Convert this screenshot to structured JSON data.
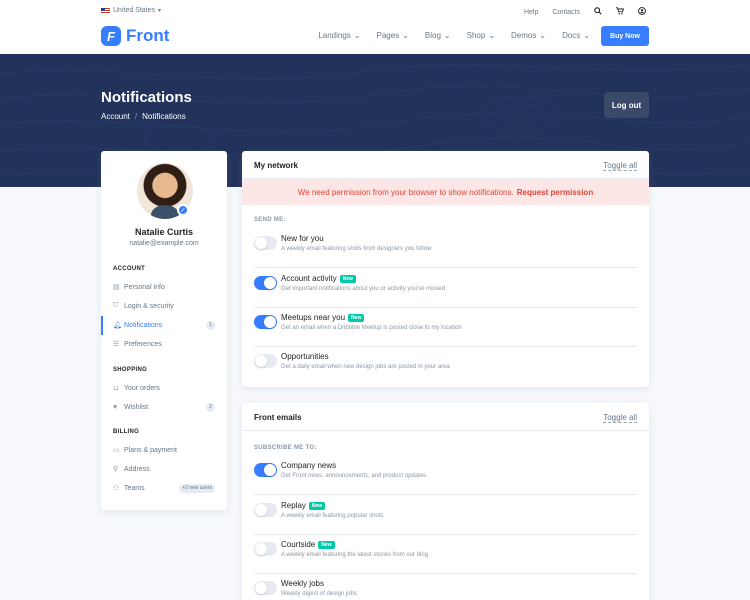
{
  "topbar": {
    "country": "United States",
    "links": [
      "Help",
      "Contacts"
    ],
    "brand": "Front",
    "brand_mark": "F",
    "nav": [
      "Landings",
      "Pages",
      "Blog",
      "Shop",
      "Demos",
      "Docs"
    ],
    "buy_label": "Buy Now"
  },
  "hero": {
    "title": "Notifications",
    "breadcrumb": [
      "Account",
      "Notifications"
    ],
    "logout_label": "Log out"
  },
  "profile": {
    "name": "Natalie Curtis",
    "email": "natalie@example.com"
  },
  "sidebar": {
    "account_heading": "ACCOUNT",
    "account_items": [
      {
        "label": "Personal info",
        "icon": "id-card-icon"
      },
      {
        "label": "Login & security",
        "icon": "shield-icon"
      },
      {
        "label": "Notifications",
        "icon": "bell-icon",
        "badge": "1",
        "active": true
      },
      {
        "label": "Preferences",
        "icon": "sliders-icon"
      }
    ],
    "shopping_heading": "SHOPPING",
    "shopping_items": [
      {
        "label": "Your orders",
        "icon": "basket-icon"
      },
      {
        "label": "Wishlist",
        "icon": "heart-icon",
        "badge": "2"
      }
    ],
    "billing_heading": "BILLING",
    "billing_items": [
      {
        "label": "Plans & payment",
        "icon": "credit-card-icon"
      },
      {
        "label": "Address",
        "icon": "map-pin-icon"
      },
      {
        "label": "Teams",
        "icon": "people-icon",
        "badge": "+2 new users"
      }
    ]
  },
  "network": {
    "title": "My network",
    "toggle_all": "Toggle all",
    "alert_text": "We need permission from your browser to show notifications.",
    "alert_link": "Request permission",
    "section_label": "SEND ME:",
    "items": [
      {
        "title": "New for you",
        "desc": "A weekly email featuring shots from designers you follow",
        "on": false,
        "new": ""
      },
      {
        "title": "Account activity",
        "desc": "Get important notifications about you or activity you've missed",
        "on": true,
        "new": "New"
      },
      {
        "title": "Meetups near you",
        "desc": "Get an email when a Dribbble Meetup is posted close to my location",
        "on": true,
        "new": "New"
      },
      {
        "title": "Opportunities",
        "desc": "Get a daily email when new design jobs are posted in your area",
        "on": false,
        "new": ""
      }
    ]
  },
  "emails": {
    "title": "Front emails",
    "toggle_all": "Toggle all",
    "section_label": "SUBSCRIBE ME TO:",
    "items": [
      {
        "title": "Company news",
        "desc": "Get Front news, announcements, and product updates",
        "on": true,
        "new": ""
      },
      {
        "title": "Replay",
        "desc": "A weekly email featuring popular shots",
        "on": false,
        "new": "New"
      },
      {
        "title": "Courtside",
        "desc": "A weekly email featuring the latest stories from our blog",
        "on": false,
        "new": "New"
      },
      {
        "title": "Weekly jobs",
        "desc": "Weekly digest of design jobs",
        "on": false,
        "new": ""
      }
    ]
  },
  "colors": {
    "primary": "#377dff",
    "hero_bg": "#21325b",
    "success_badge": "#00c9a7",
    "alert_text": "#de4437",
    "alert_bg": "#fde7e6"
  }
}
